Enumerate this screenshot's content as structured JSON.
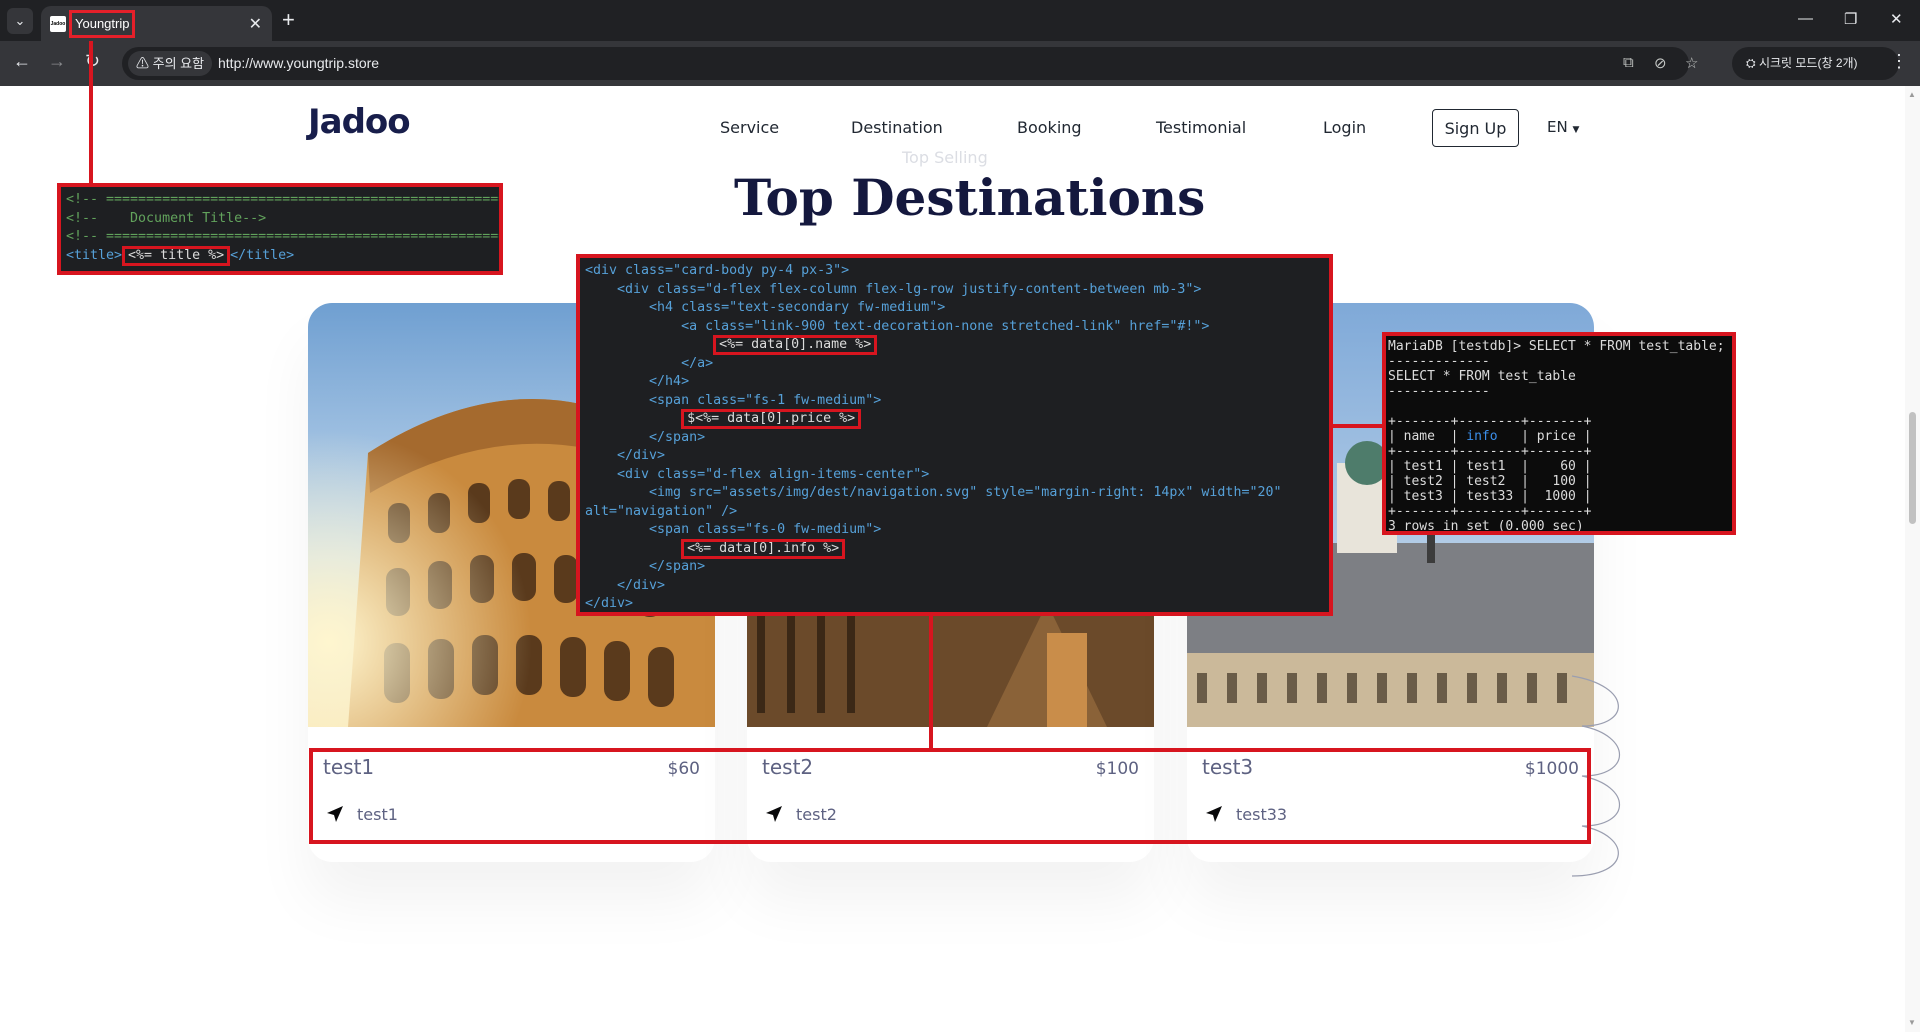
{
  "browser": {
    "tab_title": "Youngtrip",
    "favicon_text": "Jadoo",
    "security_chip": "주의 요함",
    "url": "http://www.youngtrip.store",
    "profile_chip": "시크릿 모드(창 2개)"
  },
  "site": {
    "logo": "Jadoo",
    "nav": [
      "Service",
      "Destination",
      "Booking",
      "Testimonial",
      "Login"
    ],
    "signup": "Sign Up",
    "language": "EN",
    "subtitle": "Top Selling",
    "heading": "Top Destinations"
  },
  "cards": [
    {
      "name": "test1",
      "price": "$60",
      "info": "test1"
    },
    {
      "name": "test2",
      "price": "$100",
      "info": "test2"
    },
    {
      "name": "test3",
      "price": "$1000",
      "info": "test33"
    }
  ],
  "annotations": {
    "title_code": {
      "line1": "<!-- ==================================================-->",
      "line2": "<!--    Document Title-->",
      "line3": "<!-- ==================================================-->",
      "title_open": "<title>",
      "title_expr": "<%= title %>",
      "title_close": "</title>"
    },
    "card_code": {
      "l01": "<div class=\"card-body py-4 px-3\">",
      "l02": "    <div class=\"d-flex flex-column flex-lg-row justify-content-between mb-3\">",
      "l03": "        <h4 class=\"text-secondary fw-medium\">",
      "l04": "            <a class=\"link-900 text-decoration-none stretched-link\" href=\"#!\">",
      "l05_expr": "<%= data[0].name %>",
      "l06": "            </a>",
      "l07": "        </h4>",
      "l08": "        <span class=\"fs-1 fw-medium\">",
      "l09_expr": "$<%= data[0].price %>",
      "l10": "        </span>",
      "l11": "    </div>",
      "l12": "    <div class=\"d-flex align-items-center\">",
      "l13": "        <img src=\"assets/img/dest/navigation.svg\" style=\"margin-right: 14px\" width=\"20\"",
      "l14": "alt=\"navigation\" />",
      "l15": "        <span class=\"fs-0 fw-medium\">",
      "l16_expr": "<%= data[0].info %>",
      "l17": "        </span>",
      "l18": "    </div>",
      "l19": "</div>"
    },
    "sql": {
      "prompt": "MariaDB [testdb]> SELECT * FROM test_table;",
      "sep1": "-------------",
      "query": "SELECT * FROM test_table",
      "sep2": "-------------",
      "border": "+-------+--------+-------+",
      "col_name": "name",
      "col_info": "info",
      "col_price": "price",
      "rows": [
        {
          "name": "test1",
          "info": "test1",
          "price": "60"
        },
        {
          "name": "test2",
          "info": "test2",
          "price": "100"
        },
        {
          "name": "test3",
          "info": "test33",
          "price": "1000"
        }
      ],
      "footer": "3 rows in set (0.000 sec)"
    }
  },
  "colors": {
    "annotation_red": "#d7151f",
    "heading_navy": "#14183e",
    "chrome_dark": "#202124"
  }
}
